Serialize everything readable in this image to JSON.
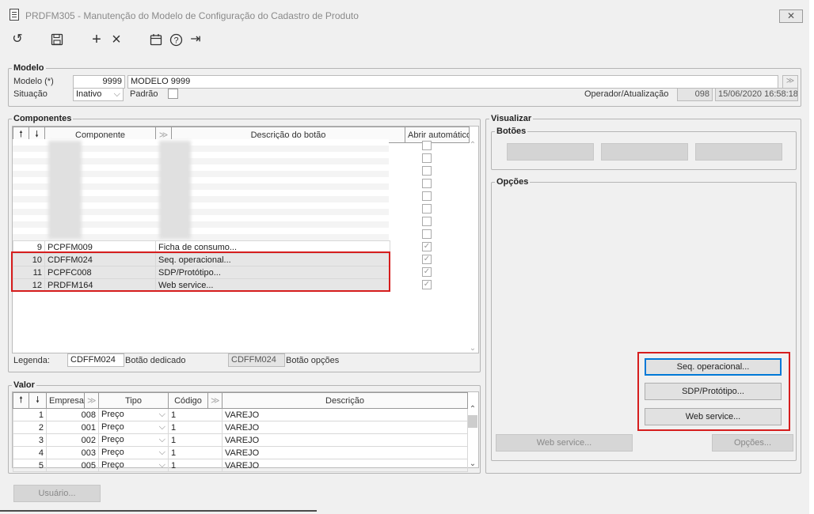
{
  "window": {
    "title": "PRDFM305 - Manutenção do Modelo de Configuração do Cadastro de Produto",
    "close": "✕"
  },
  "toolbar": {
    "undo_icon": "↺",
    "save_icon": "save-icon",
    "add_icon": "+",
    "delete_icon": "×",
    "calendar_icon": "calendar-icon",
    "help_icon": "?",
    "exit_icon": "⇥"
  },
  "modelo": {
    "legend": "Modelo",
    "modelo_label": "Modelo (*)",
    "modelo_code": "9999",
    "modelo_name": "MODELO 9999",
    "situacao_label": "Situação",
    "situacao_value": "Inativo",
    "padrao_label": "Padrão",
    "operador_label": "Operador/Atualização",
    "operador_value": "098",
    "atualizacao_value": "15/06/2020 16:58:18"
  },
  "componentes": {
    "legend": "Componentes",
    "col_componente": "Componente",
    "col_descricao": "Descrição do botão",
    "col_abrir": "Abrir automático",
    "rows": [
      {
        "n": "9",
        "code": "PCPFM009",
        "desc": "Ficha de consumo..."
      },
      {
        "n": "10",
        "code": "CDFFM024",
        "desc": "Seq. operacional..."
      },
      {
        "n": "11",
        "code": "PCPFC008",
        "desc": "SDP/Protótipo..."
      },
      {
        "n": "12",
        "code": "PRDFM164",
        "desc": "Web service..."
      }
    ],
    "legenda_label": "Legenda:",
    "legenda_value1": "CDFFM024",
    "botao_dedicado": "Botão dedicado",
    "legenda_value2": "CDFFM024",
    "botao_opcoes": "Botão opções"
  },
  "valor": {
    "legend": "Valor",
    "col_empresa": "Empresa",
    "col_tipo": "Tipo",
    "col_codigo": "Código",
    "col_descricao": "Descrição",
    "rows": [
      {
        "n": "1",
        "empresa": "008",
        "tipo": "Preço",
        "codigo": "1",
        "descricao": "VAREJO"
      },
      {
        "n": "2",
        "empresa": "001",
        "tipo": "Preço",
        "codigo": "1",
        "descricao": "VAREJO"
      },
      {
        "n": "3",
        "empresa": "002",
        "tipo": "Preço",
        "codigo": "1",
        "descricao": "VAREJO"
      },
      {
        "n": "4",
        "empresa": "003",
        "tipo": "Preço",
        "codigo": "1",
        "descricao": "VAREJO"
      },
      {
        "n": "5",
        "empresa": "005",
        "tipo": "Preço",
        "codigo": "1",
        "descricao": "VAREJO"
      }
    ]
  },
  "visualizar": {
    "legend": "Visualizar",
    "botoes_legend": "Botões",
    "opcoes_legend": "Opções",
    "btn_seq": "Seq. operacional...",
    "btn_sdp": "SDP/Protótipo...",
    "btn_web": "Web service...",
    "btn_web_bottom": "Web service...",
    "btn_opcoes": "Opções..."
  },
  "footer": {
    "usuario": "Usuário..."
  }
}
